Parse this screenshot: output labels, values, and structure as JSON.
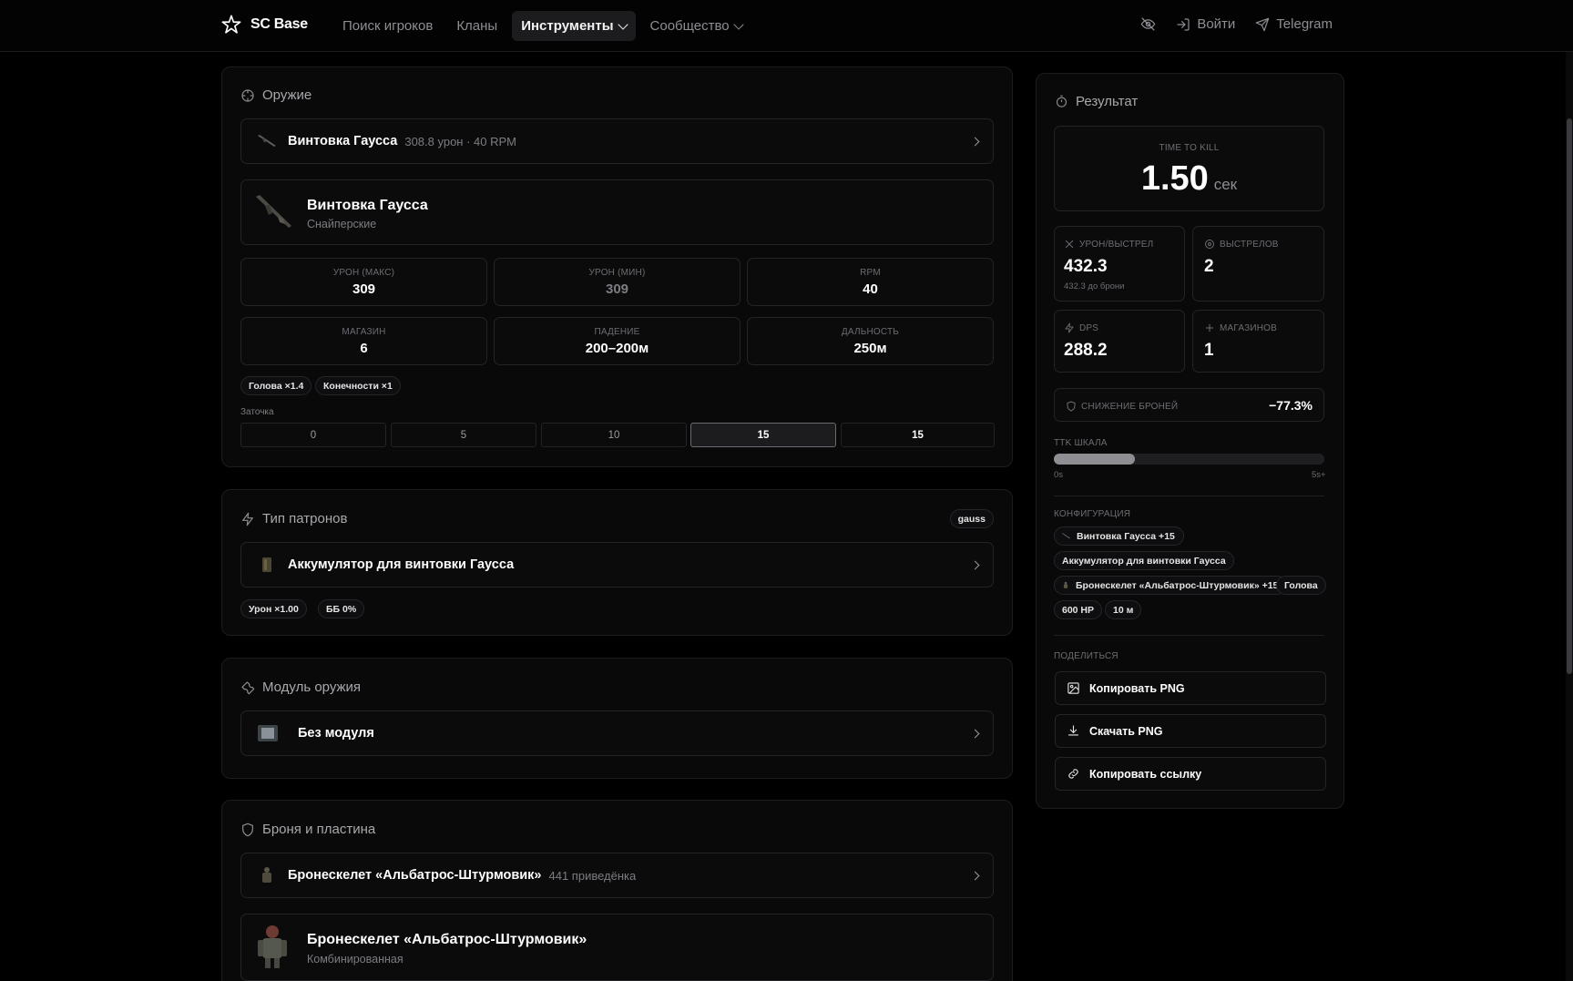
{
  "header": {
    "logo_text": "SC Base",
    "nav": [
      {
        "label": "Поиск игроков"
      },
      {
        "label": "Кланы"
      },
      {
        "label": "Инструменты"
      },
      {
        "label": "Сообщество"
      }
    ],
    "login": "Войти",
    "telegram": "Telegram"
  },
  "weapon": {
    "section_title": "Оружие",
    "selected_name": "Винтовка Гаусса",
    "selected_sub": "308.8 урон · 40 RPM",
    "detail_name": "Винтовка Гаусса",
    "detail_category": "Снайперские",
    "stats": [
      {
        "label": "УРОН (МАКС)",
        "value": "309"
      },
      {
        "label": "УРОН (МИН)",
        "value": "309"
      },
      {
        "label": "RPM",
        "value": "40"
      },
      {
        "label": "МАГАЗИН",
        "value": "6"
      },
      {
        "label": "ПАДЕНИЕ",
        "value": "200–200м"
      },
      {
        "label": "ДАЛЬНОСТЬ",
        "value": "250м"
      }
    ],
    "chips": [
      "Голова ×1.4",
      "Конечности ×1"
    ],
    "sharpen_label": "Заточка",
    "sharpen_options": [
      "0",
      "5",
      "10",
      "15",
      "15"
    ],
    "sharpen_selected": "15"
  },
  "ammo": {
    "section_title": "Тип патронов",
    "badge": "gauss",
    "selected_name": "Аккумулятор для винтовки Гаусса",
    "chips": [
      "Урон ×1.00",
      "ББ 0%"
    ]
  },
  "module": {
    "section_title": "Модуль оружия",
    "selected_name": "Без модуля"
  },
  "armor": {
    "section_title": "Броня и пластина",
    "selected_name": "Бронескелет «Альбатрос-Штурмовик»",
    "selected_sub": "441 приведёнка",
    "detail_name": "Бронескелет «Альбатрос-Штурмовик»",
    "detail_category": "Комбинированная"
  },
  "result": {
    "title": "Результат",
    "ttk_label": "TIME TO KILL",
    "ttk_value": "1.50",
    "ttk_unit": "сек",
    "damage_label": "УРОН/ВЫСТРЕЛ",
    "damage_value": "432.3",
    "damage_sub": "432.3 до брони",
    "shots_label": "ВЫСТРЕЛОВ",
    "shots_value": "2",
    "dps_label": "DPS",
    "dps_value": "288.2",
    "mags_label": "МАГАЗИНОВ",
    "mags_value": "1",
    "armor_reduction_label": "СНИЖЕНИЕ БРОНЕЙ",
    "armor_reduction_value": "−77.3%",
    "scale_label": "TTK ШКАЛА",
    "scale_min": "0s",
    "scale_max": "5s+",
    "scale_fill_fraction": 0.3,
    "config_label": "КОНФИГУРАЦИЯ",
    "config_chips": [
      "Винтовка Гаусса +15",
      "Аккумулятор для винтовки Гаусса",
      "Бронескелет «Альбатрос-Штурмовик» +15",
      "Голова",
      "600 HP",
      "10 м"
    ],
    "share_label": "ПОДЕЛИТЬСЯ",
    "share_copy_png": "Копировать PNG",
    "share_download_png": "Скачать PNG",
    "share_copy_link": "Копировать ссылку"
  }
}
